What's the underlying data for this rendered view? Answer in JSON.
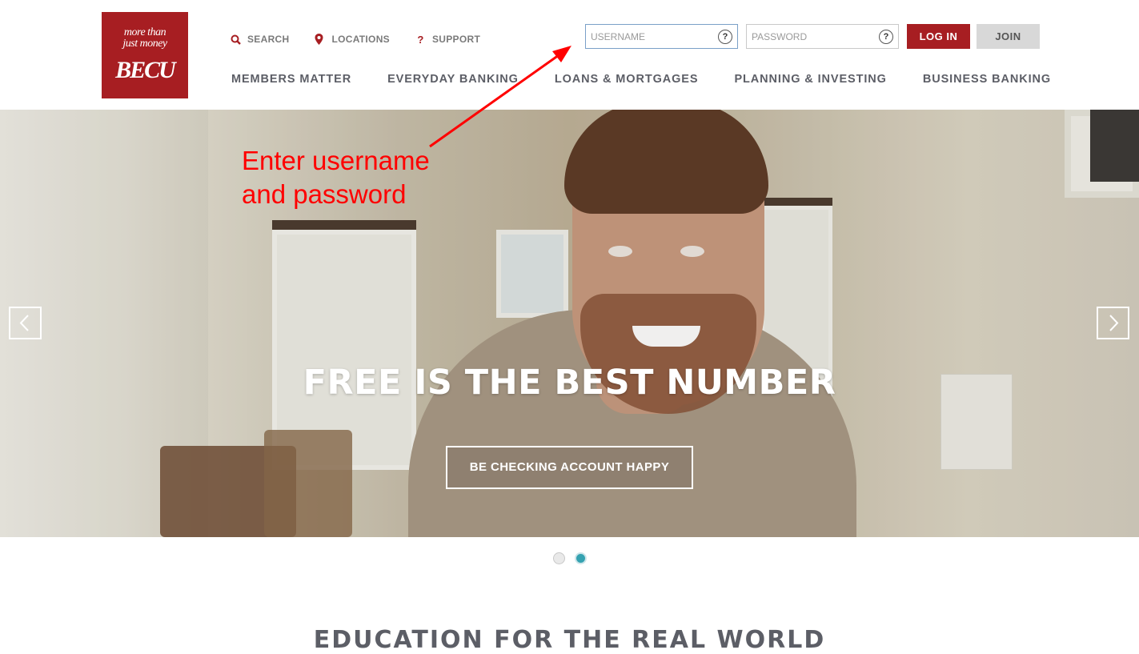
{
  "brand": {
    "tagline_line1": "more than",
    "tagline_line2": "just money",
    "name": "BECU",
    "color": "#a71e22"
  },
  "utility_nav": [
    {
      "label": "SEARCH",
      "icon": "search-icon"
    },
    {
      "label": "LOCATIONS",
      "icon": "location-pin-icon"
    },
    {
      "label": "SUPPORT",
      "icon": "question-icon"
    }
  ],
  "main_nav": [
    {
      "label": "MEMBERS MATTER"
    },
    {
      "label": "EVERYDAY BANKING"
    },
    {
      "label": "LOANS & MORTGAGES"
    },
    {
      "label": "PLANNING & INVESTING"
    },
    {
      "label": "BUSINESS BANKING"
    }
  ],
  "login": {
    "username_placeholder": "USERNAME",
    "username_value": "",
    "password_placeholder": "PASSWORD",
    "password_value": "",
    "help_glyph": "?",
    "login_label": "LOG IN",
    "join_label": "JOIN"
  },
  "hero": {
    "title": "FREE IS THE BEST NUMBER",
    "cta_label": "BE CHECKING ACCOUNT HAPPY",
    "slides_total": 2,
    "active_slide": 2
  },
  "annotation": {
    "line1": "Enter username",
    "line2": "and password",
    "color": "#ff0000"
  },
  "section": {
    "heading": "EDUCATION FOR THE REAL WORLD"
  },
  "colors": {
    "accent": "#a71e22",
    "nav_text": "#5c5e66",
    "dot_active": "#35a2b1"
  }
}
